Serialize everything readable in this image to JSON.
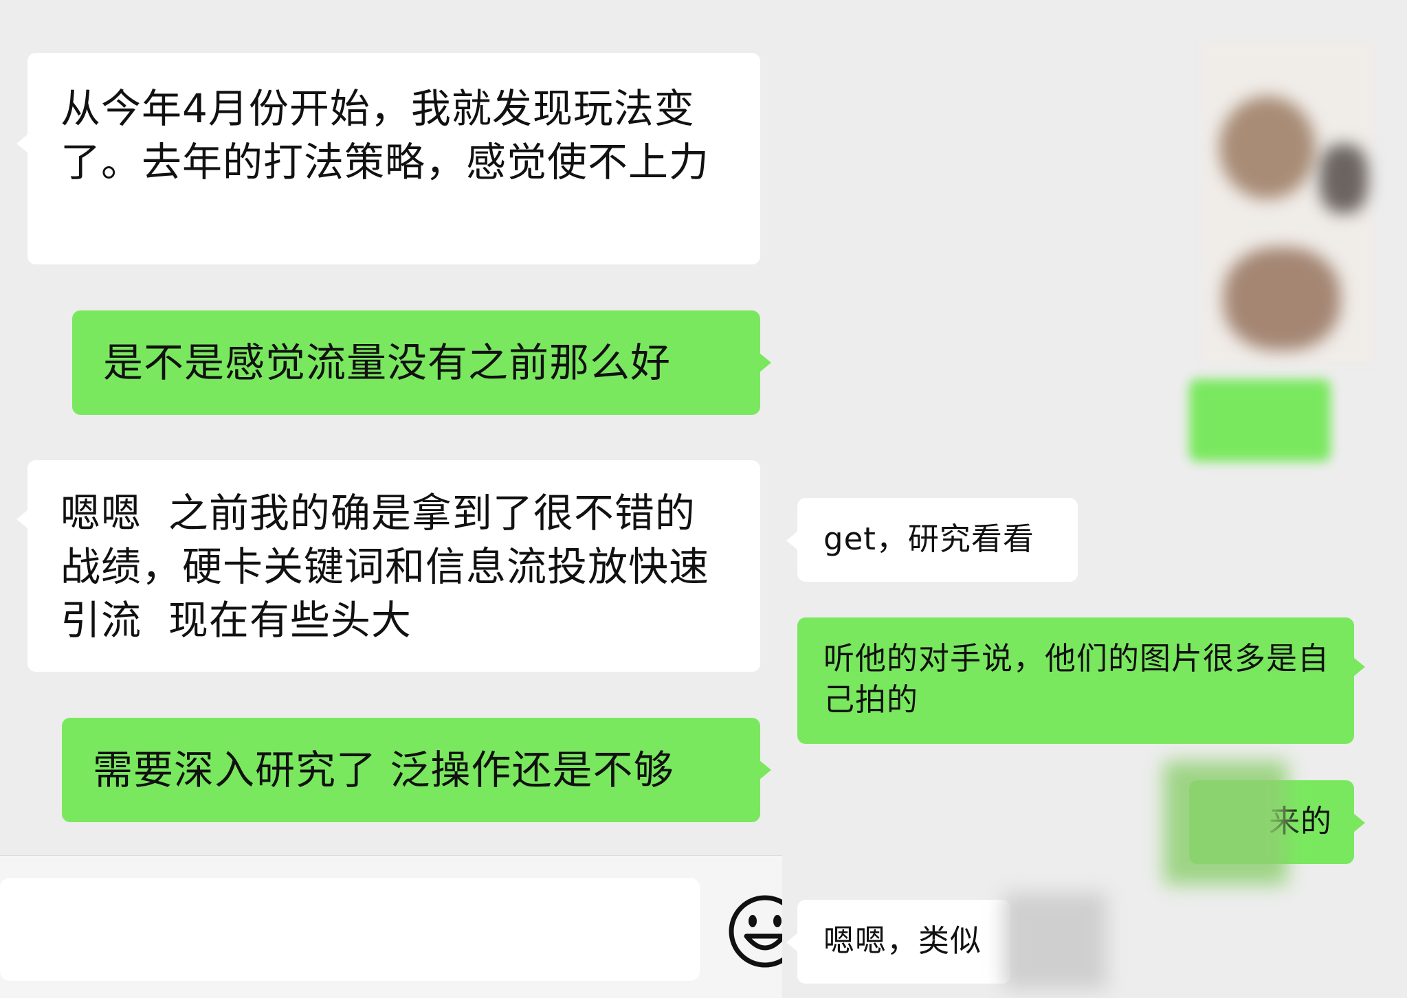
{
  "left_chat": {
    "messages": [
      {
        "side": "received",
        "text": "从今年4月份开始，我就发现玩法变了。去年的打法策略，感觉使不上力"
      },
      {
        "side": "sent",
        "text": "是不是感觉流量没有之前那么好"
      },
      {
        "side": "received",
        "text": "嗯嗯  之前我的确是拿到了很不错的战绩，硬卡关键词和信息流投放快速引流  现在有些头大"
      },
      {
        "side": "sent",
        "text": "需要深入研究了 泛操作还是不够"
      }
    ]
  },
  "right_chat": {
    "messages": [
      {
        "side": "received",
        "text": "get，研究看看"
      },
      {
        "side": "sent",
        "text": "听他的对手说，他们的图片很多是自己拍的"
      },
      {
        "side": "sent",
        "text": "来的"
      },
      {
        "side": "received",
        "text": "嗯嗯，类似"
      }
    ]
  },
  "input_bar": {
    "emoji_icon": "smiley-face-icon"
  },
  "colors": {
    "background": "#ededed",
    "received_bubble": "#ffffff",
    "sent_bubble": "#7ae85f"
  }
}
